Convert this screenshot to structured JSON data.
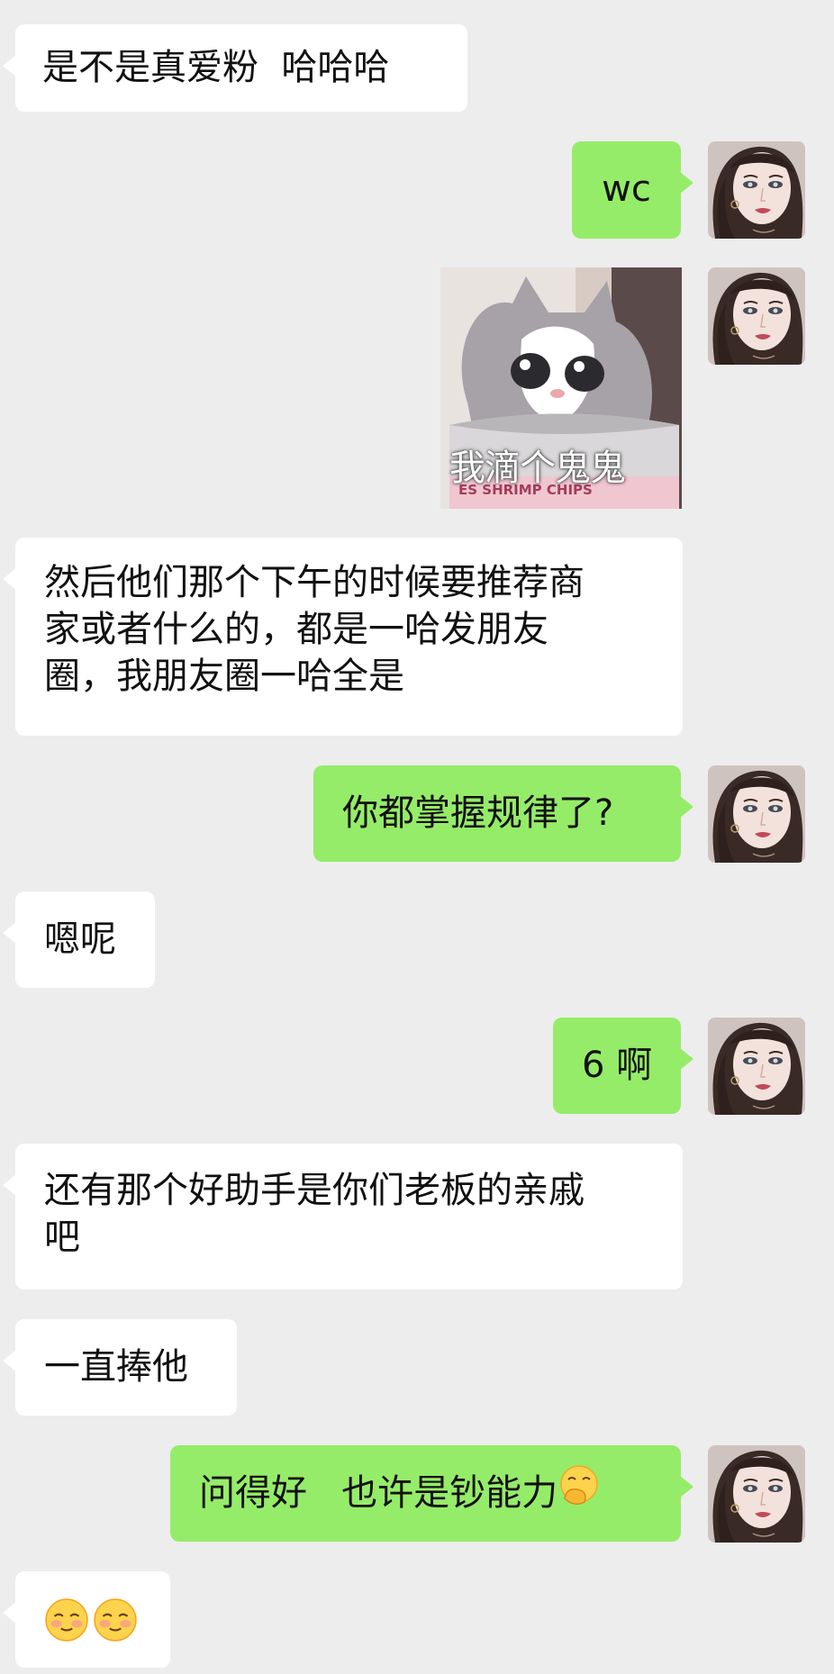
{
  "chat": {
    "messages": [
      {
        "side": "left",
        "text": "是不是真爱粉  哈哈哈"
      },
      {
        "side": "right",
        "text": "wc"
      },
      {
        "side": "right",
        "type": "sticker",
        "caption": "我滴个鬼鬼",
        "can_label": "ES SHRIMP CHIPS"
      },
      {
        "side": "left",
        "lines": [
          "然后他们那个下午的时候要推荐商",
          "家或者什么的，都是一哈发朋友",
          "圈，我朋友圈一哈全是"
        ]
      },
      {
        "side": "right",
        "text": "你都掌握规律了?"
      },
      {
        "side": "left",
        "text": "嗯呢"
      },
      {
        "side": "right",
        "text": "6 啊"
      },
      {
        "side": "left",
        "lines": [
          "还有那个好助手是你们老板的亲戚",
          "吧"
        ]
      },
      {
        "side": "left",
        "text": "一直捧他"
      },
      {
        "side": "right",
        "text": "问得好   也许是钞能力"
      },
      {
        "side": "left",
        "type": "emoji",
        "emoji": [
          "shy-smile-emoji",
          "shy-smile-emoji"
        ]
      }
    ]
  },
  "icons": {
    "hand-over-mouth": "hand-over-mouth-emoji",
    "shy-smile": "shy-smile-emoji"
  },
  "colors": {
    "background": "#ededed",
    "incoming_bubble": "#ffffff",
    "outgoing_bubble": "#95ec69"
  }
}
